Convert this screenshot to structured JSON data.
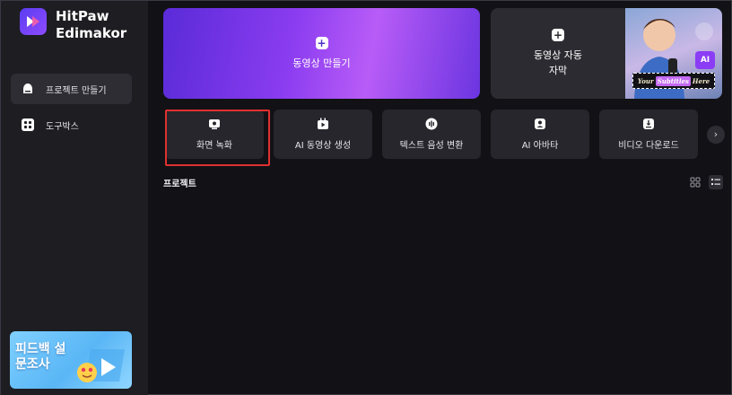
{
  "app": {
    "name": "HitPaw\nEdimakor",
    "brand_color": "#6b3cf2"
  },
  "sidebar": {
    "items": [
      {
        "label": "프로젝트 만들기",
        "icon": "home-icon",
        "active": true
      },
      {
        "label": "도구박스",
        "icon": "toolbox-icon",
        "active": false
      }
    ],
    "survey_label": "피드백 설\n문조사"
  },
  "hero": {
    "create_video_label": "동영상 만들기",
    "auto_subtitle_label": "동영상 자동\n자막",
    "thumbnail_caption": {
      "pre": "Your",
      "highlight": "Subtitles",
      "post": "Here"
    },
    "ai_badge": "AI"
  },
  "tools": [
    {
      "label": "화면 녹화",
      "icon": "screen-record-icon"
    },
    {
      "label": "AI 동영상 생성",
      "icon": "ai-video-icon"
    },
    {
      "label": "텍스트 음성 변환",
      "icon": "text-to-speech-icon"
    },
    {
      "label": "AI 아바타",
      "icon": "avatar-icon"
    },
    {
      "label": "비디오 다운로드",
      "icon": "download-icon"
    }
  ],
  "next_arrow": "›",
  "projects": {
    "title": "프로젝트",
    "view_modes": [
      "grid",
      "list"
    ],
    "active_view": "list"
  },
  "highlight_color": "#e03030"
}
